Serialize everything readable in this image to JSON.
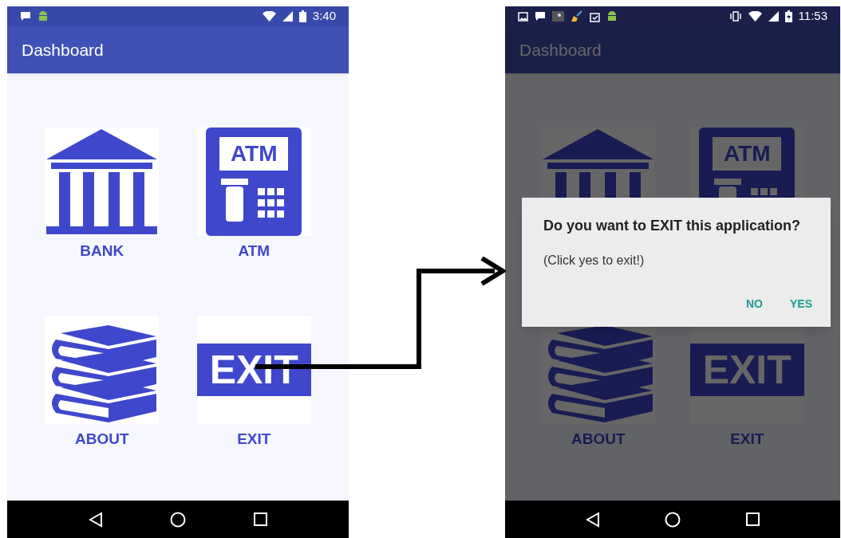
{
  "screens": [
    {
      "dimmed": false,
      "status_bar": {
        "notification_icons": [
          {
            "kind": "message"
          },
          {
            "kind": "android"
          }
        ],
        "system_icons": [
          {
            "kind": "wifi"
          },
          {
            "kind": "signal"
          },
          {
            "kind": "battery"
          }
        ],
        "time": "3:40"
      },
      "app_bar": {
        "title": "Dashboard"
      },
      "tiles": [
        {
          "kind": "bank",
          "label": "BANK"
        },
        {
          "kind": "atm",
          "icon_text": "ATM",
          "label": "ATM"
        },
        {
          "kind": "about",
          "label": "ABOUT"
        },
        {
          "kind": "exit",
          "icon_text": "EXIT",
          "label": "EXIT"
        }
      ]
    },
    {
      "dimmed": true,
      "status_bar": {
        "notification_icons": [
          {
            "kind": "image"
          },
          {
            "kind": "message"
          },
          {
            "kind": "photo"
          },
          {
            "kind": "broom"
          },
          {
            "kind": "clipboard"
          },
          {
            "kind": "android"
          }
        ],
        "system_icons": [
          {
            "kind": "vibrate"
          },
          {
            "kind": "wifi"
          },
          {
            "kind": "signal"
          },
          {
            "kind": "battery_charging"
          }
        ],
        "time": "11:53"
      },
      "app_bar": {
        "title": "Dashboard"
      },
      "tiles": [
        {
          "kind": "bank"
        },
        {
          "kind": "atm",
          "icon_text": "ATM"
        },
        {
          "kind": "about",
          "label": "ABOUT"
        },
        {
          "kind": "exit",
          "icon_text": "EXIT",
          "label": "EXIT"
        }
      ],
      "dialog": {
        "title": "Do you want to EXIT this application?",
        "message": "(Click yes to exit!)",
        "buttons": [
          "NO",
          "YES"
        ]
      }
    }
  ]
}
